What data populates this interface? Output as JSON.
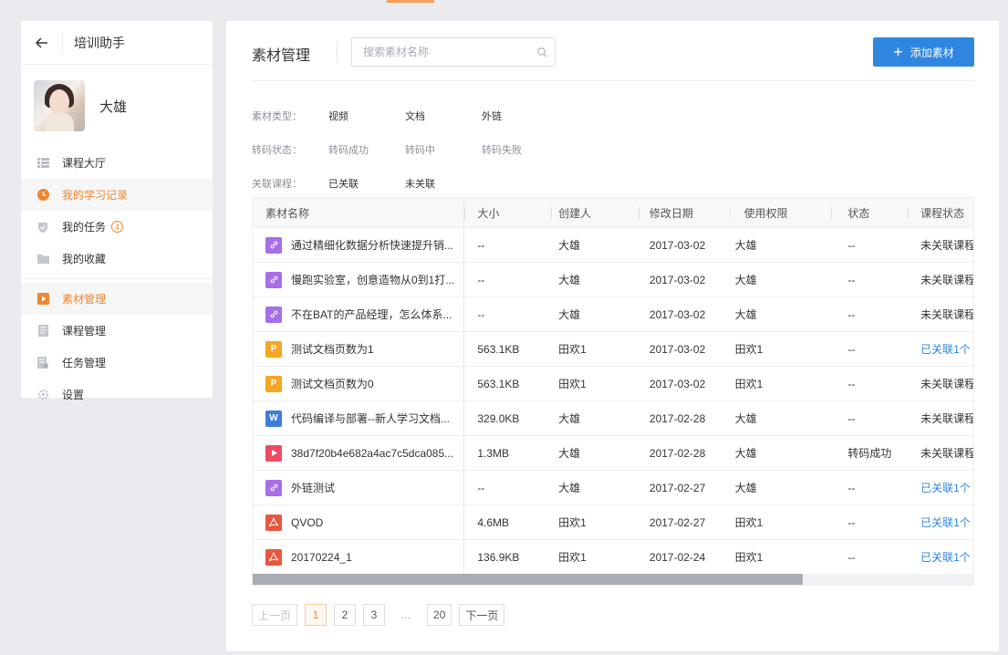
{
  "sidebar": {
    "back_icon": "arrow-left-icon",
    "title": "培训助手",
    "user_name": "大雄",
    "items": [
      {
        "label": "课程大厅",
        "icon": "list-icon"
      },
      {
        "label": "我的学习记录",
        "icon": "clock-icon"
      },
      {
        "label": "我的任务",
        "icon": "shield-icon",
        "badge": "4"
      },
      {
        "label": "我的收藏",
        "icon": "folder-icon"
      },
      {
        "label": "素材管理",
        "icon": "media-icon"
      },
      {
        "label": "课程管理",
        "icon": "document-icon"
      },
      {
        "label": "任务管理",
        "icon": "task-icon"
      },
      {
        "label": "设置",
        "icon": "gear-icon"
      }
    ]
  },
  "header": {
    "title": "素材管理",
    "search_placeholder": "搜索素材名称",
    "add_label": "添加素材"
  },
  "filters": {
    "type": {
      "label": "素材类型：",
      "options": [
        "视频",
        "文档",
        "外链"
      ]
    },
    "transcode": {
      "label": "转码状态：",
      "options": [
        "转码成功",
        "转码中",
        "转码失败"
      ]
    },
    "course": {
      "label": "关联课程：",
      "options": [
        "已关联",
        "未关联"
      ]
    }
  },
  "table": {
    "headers": [
      "素材名称",
      "大小",
      "创建人",
      "修改日期",
      "使用权限",
      "状态",
      "课程状态"
    ],
    "rows": [
      {
        "type": "link",
        "type_label": "",
        "name": "通过精细化数据分析快速提升销...",
        "size": "--",
        "creator": "大雄",
        "date": "2017-03-02",
        "perm": "大雄",
        "state": "--",
        "course": "未关联课程"
      },
      {
        "type": "link",
        "type_label": "",
        "name": "慢跑实验室，创意造物从0到1打...",
        "size": "--",
        "creator": "大雄",
        "date": "2017-03-02",
        "perm": "大雄",
        "state": "--",
        "course": "未关联课程"
      },
      {
        "type": "link",
        "type_label": "",
        "name": "不在BAT的产品经理，怎么体系...",
        "size": "--",
        "creator": "大雄",
        "date": "2017-03-02",
        "perm": "大雄",
        "state": "--",
        "course": "未关联课程"
      },
      {
        "type": "ppt",
        "type_label": "P",
        "name": "测试文档页数为1",
        "size": "563.1KB",
        "creator": "田欢1",
        "date": "2017-03-02",
        "perm": "田欢1",
        "state": "--",
        "course": "已关联1个"
      },
      {
        "type": "ppt",
        "type_label": "P",
        "name": "测试文档页数为0",
        "size": "563.1KB",
        "creator": "田欢1",
        "date": "2017-03-02",
        "perm": "田欢1",
        "state": "--",
        "course": "未关联课程"
      },
      {
        "type": "word",
        "type_label": "W",
        "name": "代码编译与部署--新人学习文档...",
        "size": "329.0KB",
        "creator": "大雄",
        "date": "2017-02-28",
        "perm": "大雄",
        "state": "--",
        "course": "未关联课程"
      },
      {
        "type": "video",
        "type_label": "",
        "name": "38d7f20b4e682a4ac7c5dca085...",
        "size": "1.3MB",
        "creator": "大雄",
        "date": "2017-02-28",
        "perm": "大雄",
        "state": "转码成功",
        "course": "未关联课程"
      },
      {
        "type": "link",
        "type_label": "",
        "name": "外链测试",
        "size": "--",
        "creator": "大雄",
        "date": "2017-02-27",
        "perm": "大雄",
        "state": "--",
        "course": "已关联1个"
      },
      {
        "type": "pdf",
        "type_label": "",
        "name": "QVOD",
        "size": "4.6MB",
        "creator": "田欢1",
        "date": "2017-02-27",
        "perm": "田欢1",
        "state": "--",
        "course": "已关联1个"
      },
      {
        "type": "pdf",
        "type_label": "",
        "name": "20170224_1",
        "size": "136.9KB",
        "creator": "田欢1",
        "date": "2017-02-24",
        "perm": "田欢1",
        "state": "--",
        "course": "已关联1个"
      }
    ]
  },
  "pagination": {
    "prev": "上一页",
    "pages": [
      "1",
      "2",
      "3"
    ],
    "ellipsis": "...",
    "last": "20",
    "next": "下一页",
    "current": "1"
  },
  "colors": {
    "accent": "#f08530",
    "primary": "#2f86e0"
  }
}
